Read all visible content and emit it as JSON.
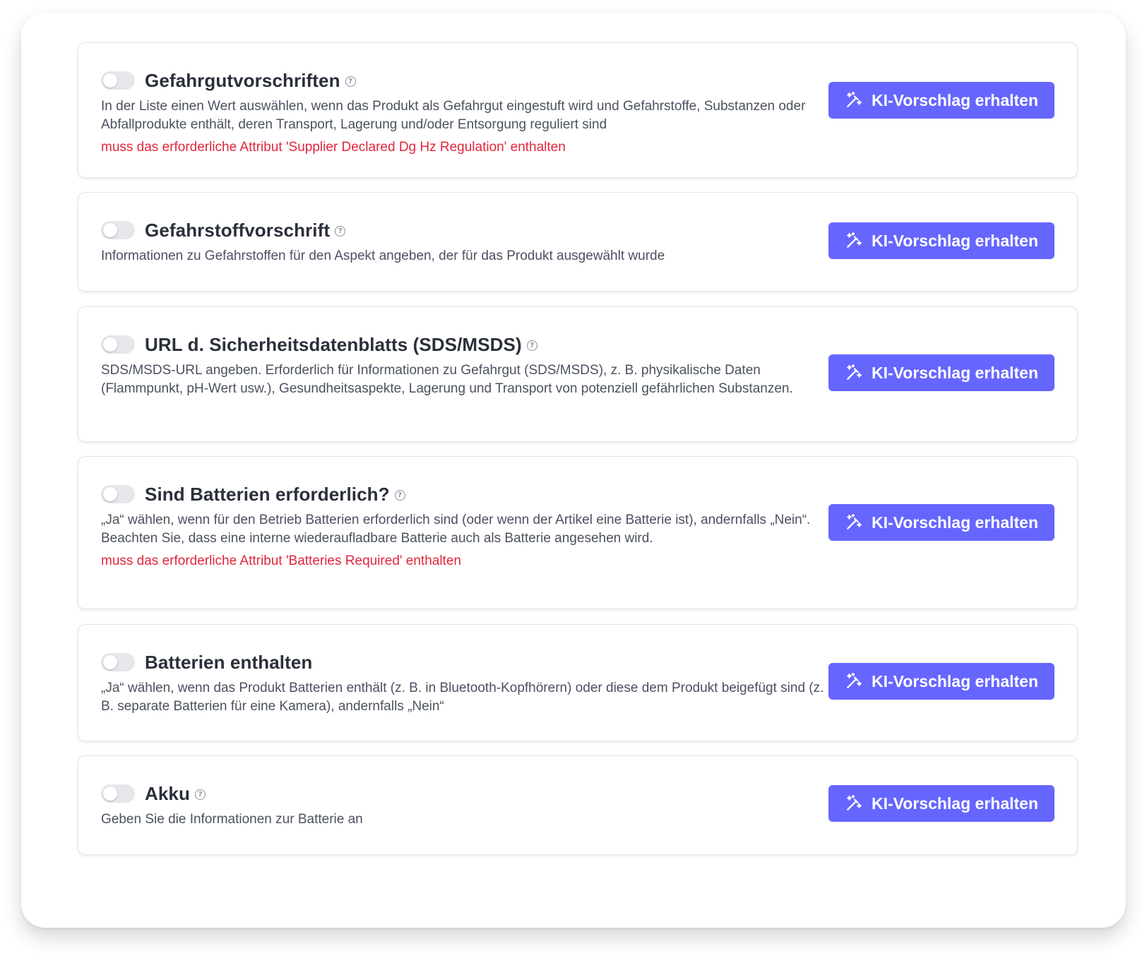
{
  "colors": {
    "accent": "#6666ff",
    "error": "#e0263a",
    "title": "#2a2f3a",
    "text": "#4b5160"
  },
  "button_label": "KI-Vorschlag erhalten",
  "button_icon": "magic-wand-icon",
  "help_icon": "question-circle-icon",
  "cards": [
    {
      "title": "Gefahrgutvorschriften",
      "has_help": true,
      "toggle_on": false,
      "description": "In der Liste einen Wert auswählen, wenn das Produkt als Gefahrgut eingestuft wird und Gefahrstoffe, Substanzen oder Abfallprodukte enthält, deren Transport, Lagerung und/oder Entsorgung reguliert sind",
      "error": "muss das erforderliche Attribut 'Supplier Declared Dg Hz Regulation' enthalten"
    },
    {
      "title": "Gefahrstoffvorschrift",
      "has_help": true,
      "toggle_on": false,
      "description": "Informationen zu Gefahrstoffen für den Aspekt angeben, der für das Produkt ausgewählt wurde"
    },
    {
      "title": "URL d. Sicherheitsdatenblatts (SDS/MSDS)",
      "has_help": true,
      "toggle_on": false,
      "description": "SDS/MSDS-URL angeben. Erforderlich für Informationen zu Gefahrgut (SDS/MSDS), z. B. physikalische Daten (Flammpunkt, pH-Wert usw.), Gesundheitsaspekte, Lagerung und Transport von potenziell gefährlichen Substanzen."
    },
    {
      "title": "Sind Batterien erforderlich?",
      "has_help": true,
      "toggle_on": false,
      "description": "„Ja“ wählen, wenn für den Betrieb Batterien erforderlich sind (oder wenn der Artikel eine Batterie ist), andernfalls „Nein“. Beachten Sie, dass eine interne wiederaufladbare Batterie auch als Batterie angesehen wird.",
      "error": "muss das erforderliche Attribut 'Batteries Required' enthalten"
    },
    {
      "title": "Batterien enthalten",
      "has_help": false,
      "toggle_on": false,
      "description": "„Ja“ wählen, wenn das Produkt Batterien enthält (z. B. in Bluetooth-Kopfhörern) oder diese dem Produkt beigefügt sind (z. B. separate Batterien für eine Kamera), andernfalls „Nein“"
    },
    {
      "title": "Akku",
      "has_help": true,
      "toggle_on": false,
      "description": "Geben Sie die Informationen zur Batterie an"
    }
  ]
}
